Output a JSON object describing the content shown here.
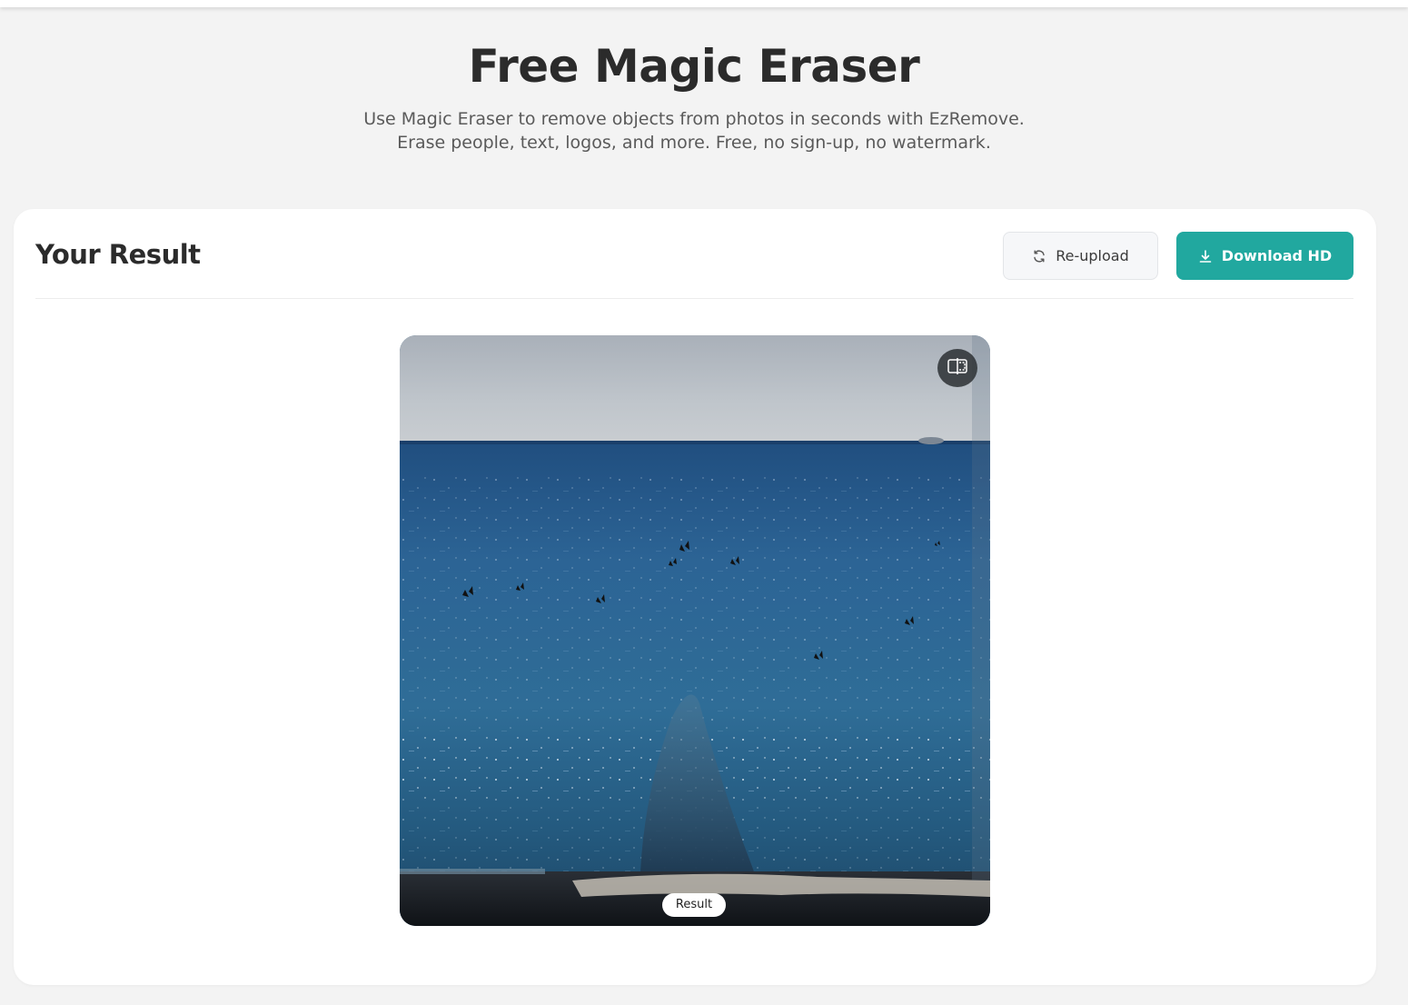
{
  "hero": {
    "title": "Free Magic Eraser",
    "subtitle_line1": "Use Magic Eraser to remove objects from photos in seconds with EzRemove.",
    "subtitle_line2": "Erase people, text, logos, and more. Free, no sign-up, no watermark."
  },
  "result": {
    "title": "Your Result",
    "reupload_label": "Re-upload",
    "download_label": "Download HD",
    "badge_label": "Result"
  },
  "icons": {
    "reupload": "refresh-icon",
    "download": "download-icon",
    "compare": "compare-split-icon"
  },
  "colors": {
    "accent": "#21a89f",
    "background": "#f3f3f3",
    "card": "#ffffff"
  }
}
